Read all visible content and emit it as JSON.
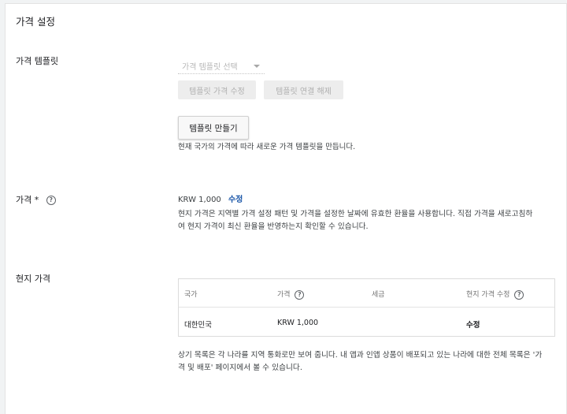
{
  "section": {
    "title": "가격 설정"
  },
  "template": {
    "label": "가격 템플릿",
    "select_placeholder": "가격 템플릿 선택",
    "edit_button": "템플릿 가격 수정",
    "unlink_button": "템플릿 연결 해제",
    "create_button": "템플릿 만들기",
    "create_desc": "현재 국가의 가격에 따라 새로운 가격 템플릿을 만듭니다."
  },
  "price": {
    "label": "가격 *",
    "value": "KRW 1,000",
    "edit_link": "수정",
    "desc_line1": "현지 가격은 지역별 가격 설정 패턴 및 가격을 설정한 날짜에 유효한 환율을 사용합니다. 직접 가격을 새로고침하",
    "desc_line2": "여 현지 가격이 최신 환율을 반영하는지 확인할 수 있습니다."
  },
  "local_price": {
    "label": "현지 가격",
    "columns": [
      "국가",
      "가격",
      "세금",
      "현지 가격 수정"
    ],
    "rows": [
      {
        "country": "대한민국",
        "price": "KRW 1,000",
        "tax": "",
        "edit": "수정"
      }
    ],
    "note_line1": "상기 목록은 각 나라를 지역 통화로만 보여 줍니다. 내 앱과 인앱 상품이 배포되고 있는 나라에 대한 전체 목록은 '가",
    "note_line2": "격 및 배포' 페이지에서 볼 수 있습니다."
  },
  "colors": {
    "link": "#1a56a8",
    "disabled_bg": "#ededed"
  }
}
